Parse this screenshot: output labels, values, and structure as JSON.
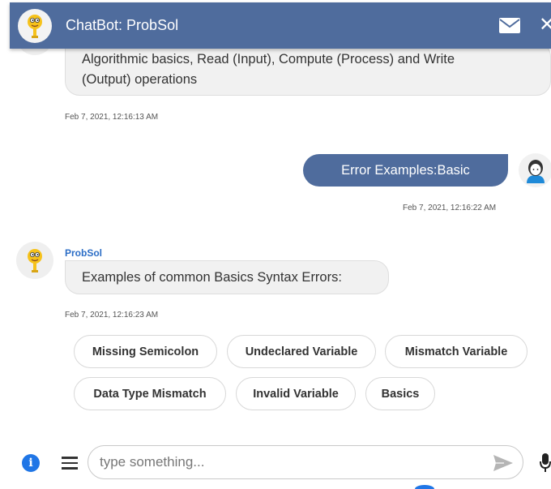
{
  "header": {
    "title": "ChatBot: ProbSol",
    "icons": [
      "bot-avatar",
      "mail-icon",
      "close-icon"
    ],
    "close_glyph": "✕",
    "color": "#4f6c9d"
  },
  "messages": {
    "first": {
      "text": "Algorithmic basics, Read (Input), Compute (Process) and Write (Output) operations",
      "line1": "Algorithmic basics, Read (Input), Compute (Process) and Write",
      "line2": "(Output) operations",
      "timestamp": "Feb 7, 2021, 12:16:13 AM"
    },
    "user": {
      "text": "Error Examples:Basic",
      "timestamp": "Feb 7, 2021, 12:16:22 AM"
    },
    "bot": {
      "sender": "ProbSol",
      "text": "Examples of common Basics Syntax Errors:",
      "timestamp": "Feb 7, 2021, 12:16:23 AM"
    }
  },
  "quick_replies": [
    "Missing Semicolon",
    "Undeclared Variable",
    "Mismatch Variable",
    "Data Type Mismatch",
    "Invalid Variable",
    "Basics"
  ],
  "footer": {
    "info_glyph": "i",
    "input_placeholder": "type something...",
    "input_value": "",
    "icons": [
      "info-icon",
      "menu-icon",
      "send-icon",
      "mic-icon"
    ]
  }
}
